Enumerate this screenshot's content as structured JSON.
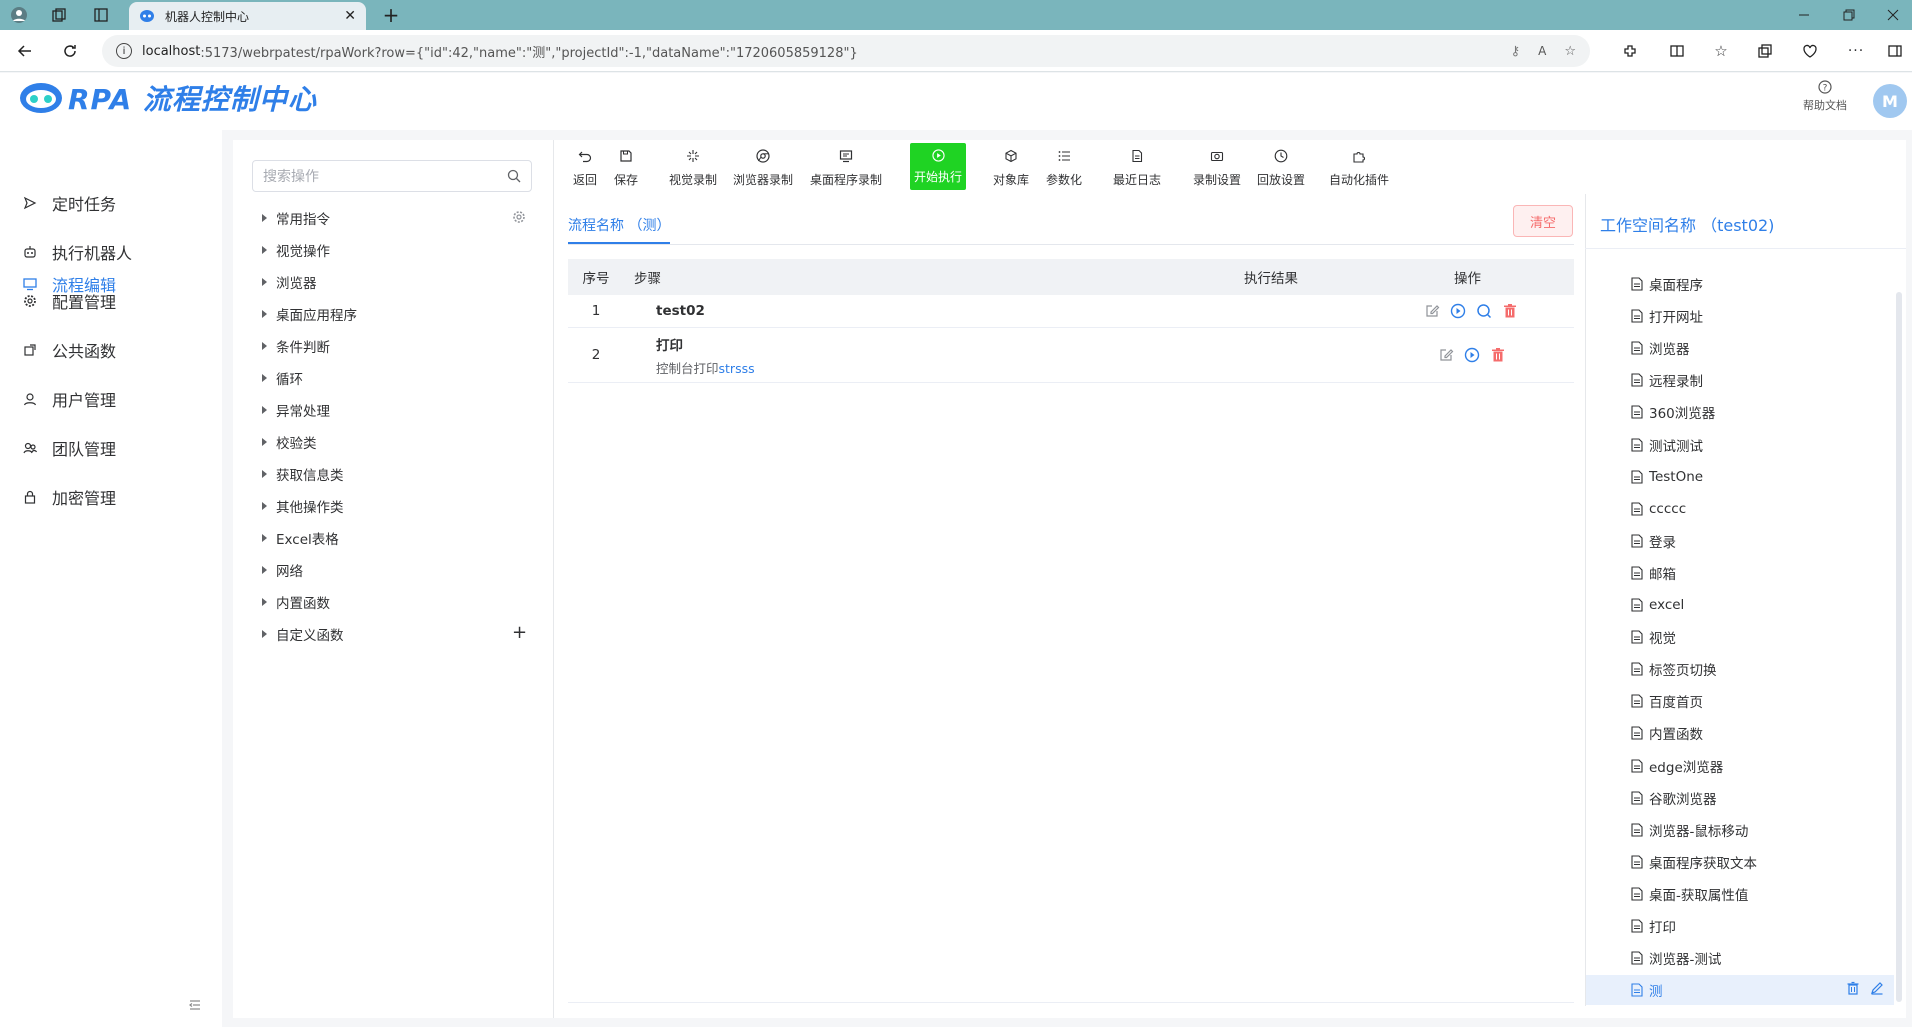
{
  "browser": {
    "tab_title": "机器人控制中心",
    "url_host": "localhost",
    "url_rest": ":5173/webrpatest/rpaWork?row={\"id\":42,\"name\":\"测\",\"projectId\":-1,\"dataName\":\"1720605859128\"}"
  },
  "header": {
    "logo_text": "RPA 流程控制中心",
    "help_label": "帮助文档",
    "avatar_letter": "M"
  },
  "nav": {
    "items": [
      {
        "label": "流程编辑",
        "icon": "monitor-icon",
        "active": true
      },
      {
        "label": "定时任务",
        "icon": "send-icon"
      },
      {
        "label": "执行机器人",
        "icon": "robot-icon"
      },
      {
        "label": "配置管理",
        "icon": "gear-icon"
      },
      {
        "label": "公共函数",
        "icon": "share-icon"
      },
      {
        "label": "用户管理",
        "icon": "user-icon"
      },
      {
        "label": "团队管理",
        "icon": "team-icon"
      },
      {
        "label": "加密管理",
        "icon": "lock-icon"
      }
    ]
  },
  "ops": {
    "search_placeholder": "搜索操作",
    "items": [
      "常用指令",
      "视觉操作",
      "浏览器",
      "桌面应用程序",
      "条件判断",
      "循环",
      "异常处理",
      "校验类",
      "获取信息类",
      "其他操作类",
      "Excel表格",
      "网络",
      "内置函数",
      "自定义函数"
    ]
  },
  "toolbar": {
    "back": "返回",
    "save": "保存",
    "visual_record": "视觉录制",
    "browser_record": "浏览器录制",
    "desktop_record": "桌面程序录制",
    "run": "开始执行",
    "object_lib": "对象库",
    "parameterize": "参数化",
    "recent_log": "最近日志",
    "record_settings": "录制设置",
    "playback_settings": "回放设置",
    "automation_plugin": "自动化插件"
  },
  "flow": {
    "tab_label": "流程名称 （测）",
    "clear_label": "清空",
    "columns": {
      "index": "序号",
      "step": "步骤",
      "result": "执行结果",
      "ops": "操作"
    },
    "rows": [
      {
        "index": "1",
        "title": "test02",
        "desc_prefix": "",
        "desc_highlight": ""
      },
      {
        "index": "2",
        "title": "打印",
        "desc_prefix": "控制台打印",
        "desc_highlight": "strsss"
      }
    ]
  },
  "workspace": {
    "title": "工作空间名称 （test02)",
    "items": [
      "桌面程序",
      "打开网址",
      "浏览器",
      "远程录制",
      "360浏览器",
      "测试测试",
      "TestOne",
      "ccccc",
      "登录",
      "邮箱",
      "excel",
      "视觉",
      "标签页切换",
      "百度首页",
      "内置函数",
      "edge浏览器",
      "谷歌浏览器",
      "浏览器-鼠标移动",
      "桌面程序获取文本",
      "桌面-获取属性值",
      "打印",
      "浏览器-测试",
      "测"
    ],
    "active_index": 22
  },
  "colors": {
    "accent": "#2f7fe8",
    "run": "#1fd323",
    "danger": "#f56c6c"
  }
}
